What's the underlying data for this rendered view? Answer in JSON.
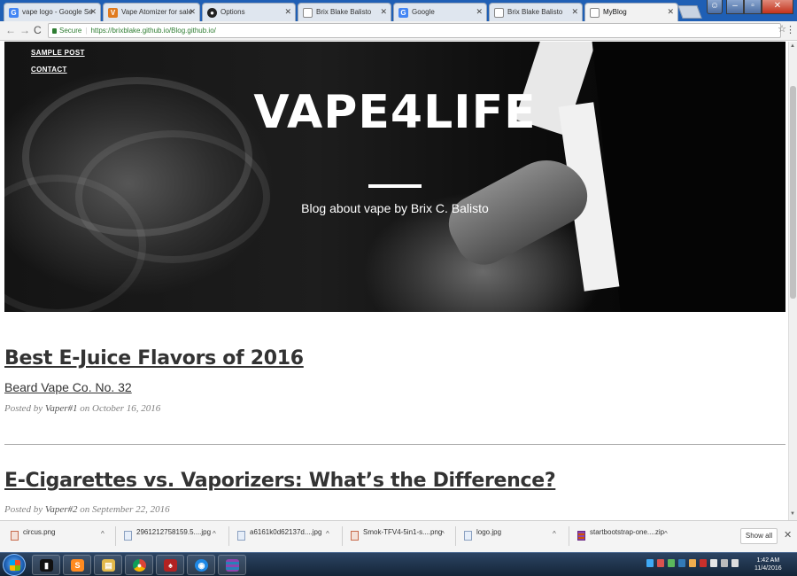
{
  "browser": {
    "tabs": [
      {
        "title": "vape logo - Google Sear",
        "favicon": "google-icon",
        "active": false
      },
      {
        "title": "Vape Atomizer for sale -",
        "favicon": "shop-icon",
        "active": false
      },
      {
        "title": "Options",
        "favicon": "github-icon",
        "active": false
      },
      {
        "title": "Brix Blake Balisto",
        "favicon": "page-icon",
        "active": false
      },
      {
        "title": "Google",
        "favicon": "google-icon",
        "active": false
      },
      {
        "title": "Brix Blake Balisto",
        "favicon": "page-icon",
        "active": false
      },
      {
        "title": "MyBlog",
        "favicon": "page-icon",
        "active": true
      }
    ],
    "address": {
      "secure_label": "Secure",
      "url": "https://brixblake.github.io/Blog.github.io/"
    }
  },
  "page": {
    "nav": {
      "links": [
        "SAMPLE POST",
        "CONTACT"
      ]
    },
    "hero": {
      "title": "VAPE4LIFE",
      "subtitle": "Blog about vape by Brix C. Balisto"
    },
    "posts": [
      {
        "title": "Best E-Juice Flavors of 2016",
        "subtitle": "Beard Vape Co. No. 32",
        "meta_prefix": "Posted by",
        "author": "Vaper#1",
        "meta_on": "on",
        "date": "October 16, 2016"
      },
      {
        "title": "E-Cigarettes vs. Vaporizers: What’s the Difference?",
        "subtitle": "",
        "meta_prefix": "Posted by",
        "author": "Vaper#2",
        "meta_on": "on",
        "date": "September 22, 2016"
      }
    ]
  },
  "downloads": {
    "items": [
      "circus.png",
      "2961212758159.5....jpg",
      "a6161k0d62137d....jpg",
      "Smok-TFV4-5in1-s....png",
      "logo.jpg",
      "startbootstrap-one....zip"
    ],
    "show_all": "Show all"
  },
  "taskbar": {
    "time": "1:42 AM",
    "date": "11/4/2016"
  },
  "colors": {
    "tabstrip": "#1f5fb5",
    "secure_green": "#2e7d32",
    "post_title": "#333333",
    "meta_gray": "#808080"
  }
}
